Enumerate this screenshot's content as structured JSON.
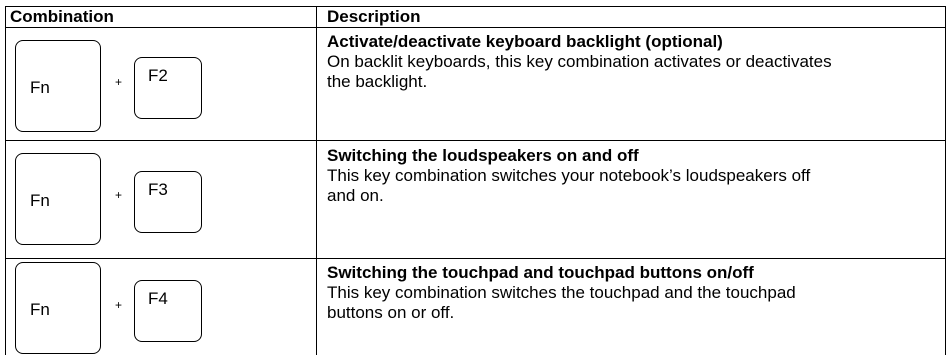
{
  "header": {
    "col1": "Combination",
    "col2": "Description"
  },
  "rows": [
    {
      "key1": "Fn",
      "plus": "+",
      "key2": "F2",
      "title": "Activate/deactivate keyboard backlight (optional)",
      "text_line1": "On backlit keyboards, this key combination activates or deactivates",
      "text_line2": "the backlight."
    },
    {
      "key1": "Fn",
      "plus": "+",
      "key2": "F3",
      "title": "Switching the loudspeakers on and off",
      "text_line1": "This key combination switches your notebook’s loudspeakers off",
      "text_line2": "and on."
    },
    {
      "key1": "Fn",
      "plus": "+",
      "key2": "F4",
      "title": "Switching the touchpad and touchpad buttons on/off",
      "text_line1": "This key combination switches the touchpad and the touchpad",
      "text_line2": "buttons on or off."
    }
  ]
}
